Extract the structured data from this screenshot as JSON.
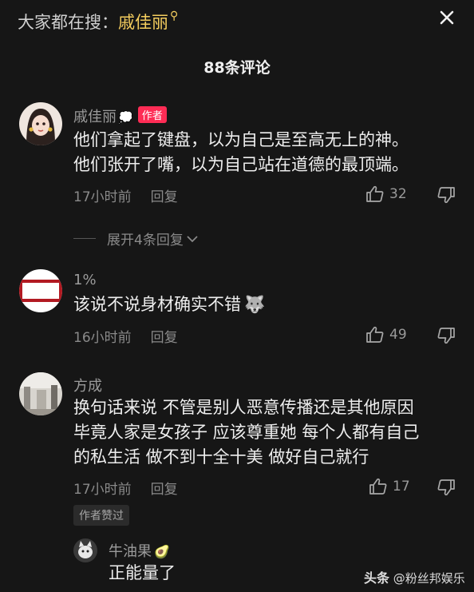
{
  "header": {
    "search_prefix": "大家都在搜：",
    "search_term": "戚佳丽"
  },
  "comment_count": "88条评论",
  "comments": [
    {
      "user": "戚佳丽",
      "badge": "作者",
      "lines": [
        "他们拿起了键盘，以为自己是至高无上的神。",
        "他们张开了嘴，以为自己站在道德的最顶端。"
      ],
      "time": "17小时前",
      "reply_label": "回复",
      "likes": "32"
    },
    {
      "user": "1%",
      "lines": [
        "该说不说身材确实不错"
      ],
      "time": "16小时前",
      "reply_label": "回复",
      "likes": "49"
    },
    {
      "user": "方成",
      "lines": [
        "换句话来说 不管是别人恶意传播还是其他原因",
        "毕竟人家是女孩子 应该尊重她 每个人都有自己",
        "的私生活 做不到十全十美 做好自己就行"
      ],
      "time": "17小时前",
      "reply_label": "回复",
      "likes": "17",
      "author_liked": "作者赞过"
    }
  ],
  "expand_replies": "展开4条回复",
  "reply": {
    "user": "牛油果",
    "text": "正能量了"
  },
  "watermark": {
    "brand": "头条",
    "handle": "@粉丝邦娱乐"
  },
  "colors": {
    "background": "#161616",
    "highlight": "#f4cd5e",
    "author_badge": "#fe2c55"
  }
}
